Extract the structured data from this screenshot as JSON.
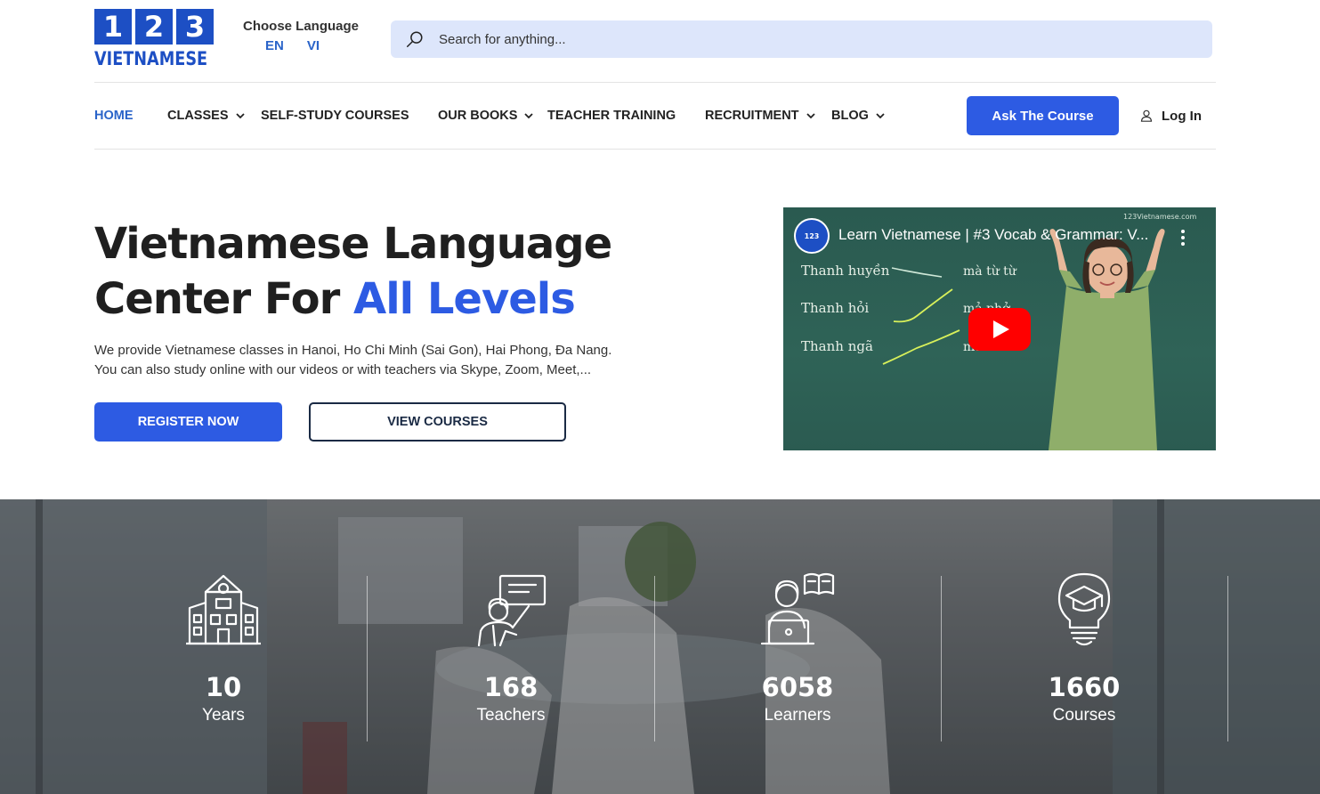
{
  "header": {
    "logo": {
      "digits": [
        "1",
        "2",
        "3"
      ],
      "word": "VIETNAMESE"
    },
    "language": {
      "title": "Choose Language",
      "options": [
        "EN",
        "VI"
      ]
    },
    "search": {
      "placeholder": "Search for anything..."
    }
  },
  "nav": {
    "items": [
      {
        "label": "HOME",
        "active": true,
        "dropdown": false
      },
      {
        "label": "CLASSES",
        "active": false,
        "dropdown": true
      },
      {
        "label": "SELF-STUDY COURSES",
        "active": false,
        "dropdown": false
      },
      {
        "label": "OUR BOOKS",
        "active": false,
        "dropdown": true
      },
      {
        "label": "TEACHER TRAINING",
        "active": false,
        "dropdown": false
      },
      {
        "label": "RECRUITMENT",
        "active": false,
        "dropdown": true
      },
      {
        "label": "BLOG",
        "active": false,
        "dropdown": true
      }
    ],
    "cta_label": "Ask The Course",
    "login_label": "Log In"
  },
  "hero": {
    "title_line1": "Vietnamese Language",
    "title_line2_prefix": "Center For ",
    "title_line2_accent": "All Levels",
    "description_line1": "We provide Vietnamese classes in Hanoi, Ho Chi Minh (Sai Gon), Hai Phong, Đa Nang.",
    "description_line2": "You can also study online with our videos or with teachers via Skype, Zoom, Meet,...",
    "register_label": "REGISTER NOW",
    "courses_label": "VIEW COURSES"
  },
  "video": {
    "channel_badge": "123",
    "title": "Learn Vietnamese | #3 Vocab & Grammar: V...",
    "board_lines": [
      "Thanh huyền",
      "Thanh hỏi",
      "Thanh ngã"
    ],
    "board_words": [
      "mà  từ  từ",
      "mả  phở",
      "mã"
    ],
    "watermark": "123Vietnamese.com"
  },
  "stats": [
    {
      "number": "10",
      "label": "Years",
      "icon": "school-building-icon"
    },
    {
      "number": "168",
      "label": "Teachers",
      "icon": "teacher-board-icon"
    },
    {
      "number": "6058",
      "label": "Learners",
      "icon": "learner-laptop-icon"
    },
    {
      "number": "1660",
      "label": "Courses",
      "icon": "graduation-bulb-icon"
    }
  ],
  "colors": {
    "brand_blue": "#1d4fc4",
    "accent_blue": "#2d5be3",
    "nav_active": "#2a64c9",
    "search_bg": "#dde6fb"
  }
}
